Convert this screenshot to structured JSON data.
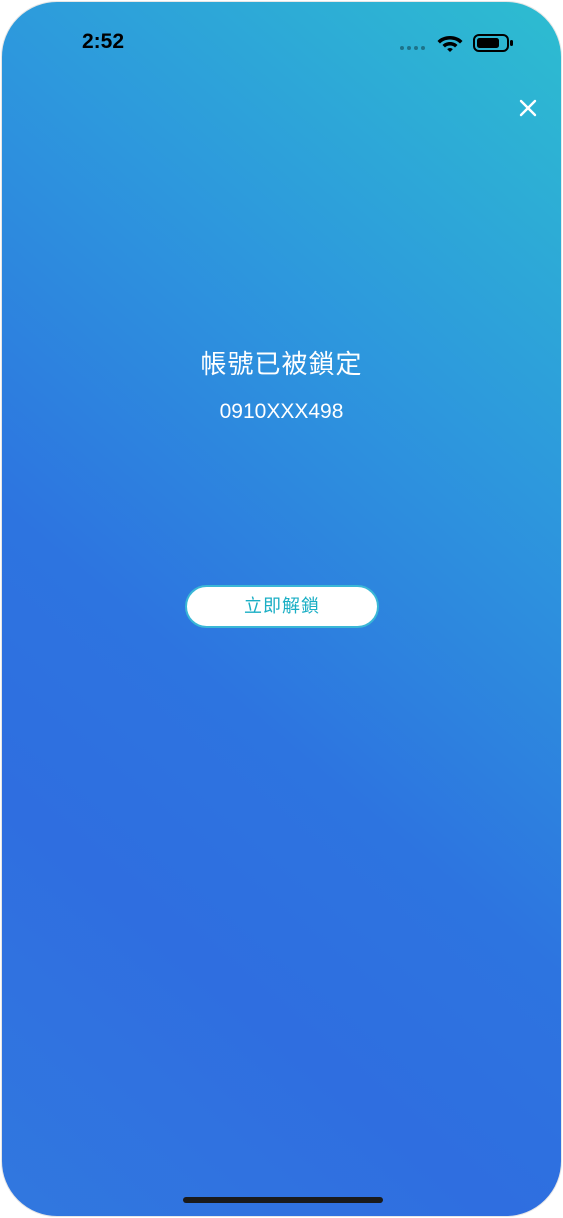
{
  "status_bar": {
    "time": "2:52",
    "wifi_icon": "wifi-icon",
    "battery_icon": "battery-icon"
  },
  "header": {
    "close_icon": "close-icon"
  },
  "main": {
    "title": "帳號已被鎖定",
    "phone_number": "0910XXX498",
    "unlock_label": "立即解鎖"
  },
  "colors": {
    "gradient_top": "#2dbdd0",
    "gradient_bottom": "#2f6ee0",
    "button_text": "#1aaec4",
    "button_border": "#3ab7d6"
  }
}
